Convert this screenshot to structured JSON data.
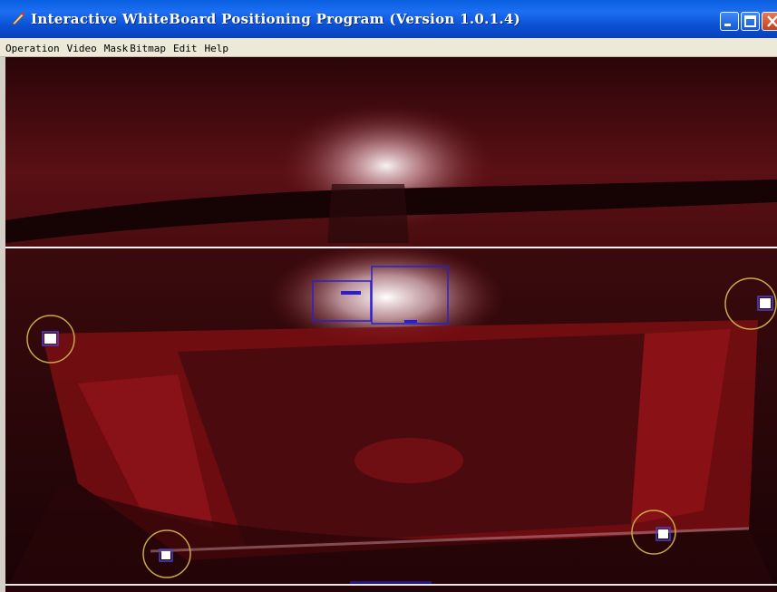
{
  "window": {
    "title": "Interactive WhiteBoard Positioning Program (Version 1.0.1.4)"
  },
  "menu": {
    "items": [
      "Operation",
      "Video",
      "Mask",
      "Bitmap",
      "Edit",
      "Help"
    ]
  },
  "video": {
    "calibration_markers": 4,
    "tracked_blobs": 2,
    "colors": {
      "frame_tint": "#7a0e12",
      "marker_circle": "#c8a84a",
      "blob_box": "#2a1fd0",
      "divider": "#f2f2f2"
    }
  }
}
